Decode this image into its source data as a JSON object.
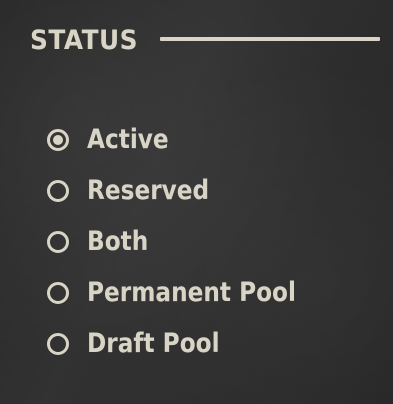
{
  "section": {
    "title": "STATUS"
  },
  "status_options": [
    {
      "label": "Active",
      "selected": true
    },
    {
      "label": "Reserved",
      "selected": false
    },
    {
      "label": "Both",
      "selected": false
    },
    {
      "label": "Permanent Pool",
      "selected": false
    },
    {
      "label": "Draft Pool",
      "selected": false
    }
  ],
  "colors": {
    "background": "#2b2b2b",
    "foreground": "#d8d5c7"
  }
}
